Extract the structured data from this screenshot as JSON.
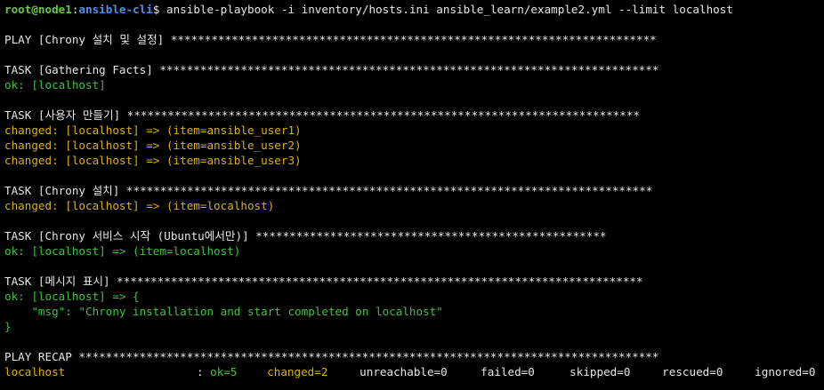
{
  "prompt": {
    "user_host": "root@node1",
    "colon": ":",
    "path": "ansible-cli",
    "dollar": "$ ",
    "command": "ansible-playbook -i inventory/hosts.ini ansible_learn/example2.yml --limit localhost"
  },
  "lines": {
    "play": "PLAY [Chrony 설치 및 설정] ************************************************************************",
    "task1": "TASK [Gathering Facts] **************************************************************************",
    "task1_r1": "ok: [localhost]",
    "task2": "TASK [사용자 만들기] ****************************************************************************",
    "task2_r1": "changed: [localhost] => (item=ansible_user1)",
    "task2_r2": "changed: [localhost] => (item=ansible_user2)",
    "task2_r3": "changed: [localhost] => (item=ansible_user3)",
    "task3": "TASK [Chrony 설치] ******************************************************************************",
    "task3_r1": "changed: [localhost] => (item=localhost)",
    "task4": "TASK [Chrony 서비스 시작 (Ubuntu에서만)] ****************************************************",
    "task4_r1": "ok: [localhost] => (item=localhost)",
    "task5": "TASK [메시지 표시] ******************************************************************************",
    "task5_r1": "ok: [localhost] => {",
    "task5_r2": "    \"msg\": \"Chrony installation and start completed on localhost\"",
    "task5_r3": "}",
    "recap": "PLAY RECAP **************************************************************************************"
  },
  "recap": {
    "host": "localhost",
    "sep": ": ",
    "ok": "ok=5",
    "changed": "changed=2",
    "unreachable": "unreachable=0",
    "failed": "failed=0",
    "skipped": "skipped=0",
    "rescued": "rescued=0",
    "ignored": "ignored=0"
  },
  "colors": {
    "background": "#000000",
    "ok": "#3fc13f",
    "changed": "#d8b018",
    "prompt_user": "#6cc644",
    "prompt_path": "#4f8fe8"
  }
}
